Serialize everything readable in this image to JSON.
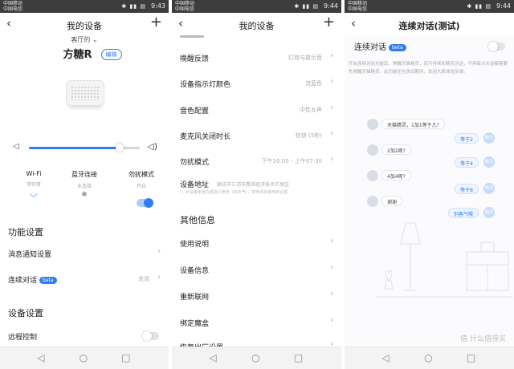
{
  "status_bar": {
    "carrier1": "中国移动",
    "carrier2": "中国电信",
    "icons": "✱ ▮▮ ▤",
    "time1": "9:43",
    "time2": "9:44",
    "time3": "9:44"
  },
  "screen1": {
    "title": "我的设备",
    "room": "客厅的 ⌄",
    "device_name": "方糖R",
    "edit_label": "编辑",
    "volume_level": 0.82,
    "quick": [
      {
        "label": "Wi-Fi",
        "value": "李帅哥"
      },
      {
        "label": "蓝牙连接",
        "value": "未连接"
      },
      {
        "label": "勿扰模式",
        "value": "开启"
      }
    ],
    "section_features": "功能设置",
    "row_notify": "消息通知设置",
    "row_continuous": "连续对话",
    "row_continuous_badge": "beta",
    "row_continuous_value": "关闭",
    "section_device": "设备设置",
    "row_remote": "远程控制"
  },
  "screen2": {
    "title": "我的设备",
    "rows": [
      {
        "label": "唤醒反馈",
        "value": "灯效与提示音"
      },
      {
        "label": "设备指示灯颜色",
        "value": "流蓝色"
      },
      {
        "label": "音色配置",
        "value": "中性女声"
      },
      {
        "label": "麦克风关闭时长",
        "value": "较快 (5秒)"
      },
      {
        "label": "勿扰模式",
        "value": "下午10:00 - 上午07:30"
      }
    ],
    "address_label": "设备地址",
    "address_value": "廊坊市三河市燕郊经济技术开发区",
    "address_note": "ⓘ 对设备使用位置进行修改（如天气），将修改来使用新设置",
    "section_other": "其他信息",
    "other_rows": [
      "使用说明",
      "设备信息",
      "重新联网",
      "绑定魔盒",
      "恢复出厂设置"
    ]
  },
  "screen3": {
    "title": "连续对话(测试)",
    "toggle_label": "连续对话",
    "badge": "beta",
    "description": "开启连续对话功能后，唤醒天猫精灵，就可持续和精灵对话，不用每次对话都需要先唤醒天猫精灵。此功能还在测试期间，欢迎大家体验反馈。",
    "chat": [
      {
        "q": "天猫精灵，1加1等于几?",
        "a": "等于2"
      },
      {
        "q": "2加2呢?",
        "a": "等于4"
      },
      {
        "q": "4加4呢?",
        "a": "等于8"
      },
      {
        "q": "谢谢",
        "a": "别客气哦"
      }
    ],
    "bot_avatar_text": "精灵",
    "watermark": "值 什么值得买"
  },
  "colors": {
    "accent": "#2f7cf6",
    "statusbar": "#3d3d3d"
  }
}
